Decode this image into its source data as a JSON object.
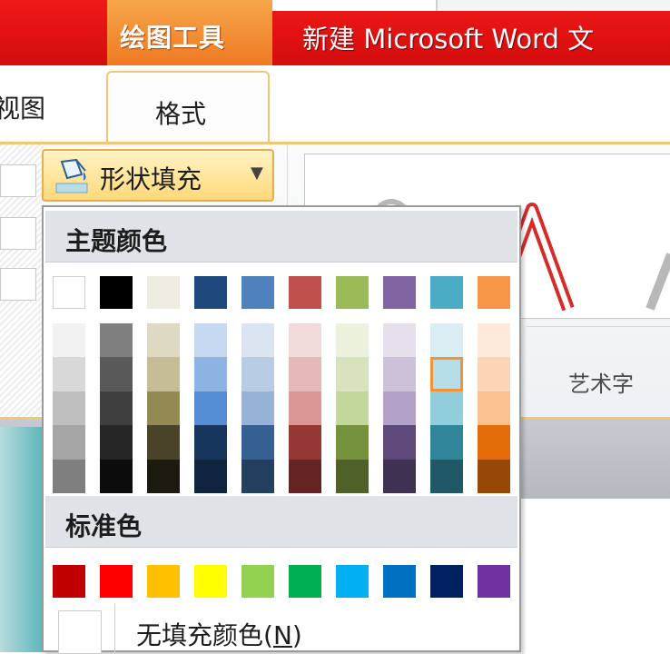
{
  "header": {
    "tool_tab": "绘图工具",
    "doc_title": "新建 Microsoft Word 文"
  },
  "tabs": {
    "view": "视图",
    "format": "格式"
  },
  "ribbon": {
    "fill_button_label": "形状填充",
    "wordart_group_label": "艺术字"
  },
  "dropdown": {
    "theme_header": "主题颜色",
    "standard_header": "标准色",
    "no_fill_label": "无填充颜色(",
    "no_fill_mnemonic": "N",
    "no_fill_close": ")"
  },
  "theme_base_colors": [
    "#ffffff",
    "#000000",
    "#eeece1",
    "#1f497d",
    "#4f81bd",
    "#c0504d",
    "#9bbb59",
    "#8064a2",
    "#4bacc6",
    "#f79646"
  ],
  "theme_shades": [
    [
      "#f2f2f2",
      "#d8d8d8",
      "#bfbfbf",
      "#a5a5a5",
      "#7f7f7f"
    ],
    [
      "#7f7f7f",
      "#595959",
      "#3f3f3f",
      "#262626",
      "#0c0c0c"
    ],
    [
      "#ddd9c3",
      "#c4bd97",
      "#938953",
      "#494429",
      "#1d1b10"
    ],
    [
      "#c6d9f0",
      "#8db3e2",
      "#548dd4",
      "#17365d",
      "#0f243e"
    ],
    [
      "#dbe5f1",
      "#b8cce4",
      "#95b3d7",
      "#366092",
      "#244061"
    ],
    [
      "#f2dcdb",
      "#e5b9b7",
      "#d99694",
      "#953734",
      "#632423"
    ],
    [
      "#ebf1dd",
      "#d7e3bc",
      "#c3d69b",
      "#76923c",
      "#4f6128"
    ],
    [
      "#e5e0ec",
      "#ccc1d9",
      "#b2a2c7",
      "#5f497a",
      "#3f3151"
    ],
    [
      "#dbeef3",
      "#b7dde8",
      "#92cddc",
      "#31859b",
      "#205867"
    ],
    [
      "#fdeada",
      "#fbd5b5",
      "#fac08f",
      "#e36c09",
      "#974806"
    ]
  ],
  "selected_swatch": {
    "column": 8,
    "row": 1
  },
  "standard_colors": [
    "#c00000",
    "#ff0000",
    "#ffc000",
    "#ffff00",
    "#92d050",
    "#00b050",
    "#00b0f0",
    "#0070c0",
    "#002060",
    "#7030a0"
  ],
  "colors": {
    "title_red": "#e01212",
    "context_orange": "#f28a30",
    "ribbon_gold": "#f1c774",
    "selection_border": "#f29436"
  }
}
